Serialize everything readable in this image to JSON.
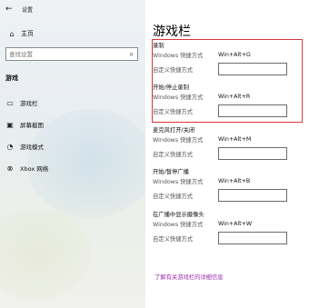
{
  "window": {
    "title": "设置"
  },
  "nav": {
    "home_label": "主页",
    "search_placeholder": "查找设置",
    "section": "游戏",
    "items": [
      {
        "label": "游戏栏",
        "icon": "game-bar-icon"
      },
      {
        "label": "屏幕截图",
        "icon": "capture-icon"
      },
      {
        "label": "游戏模式",
        "icon": "game-mode-icon"
      },
      {
        "label": "Xbox 网络",
        "icon": "xbox-icon"
      }
    ]
  },
  "main": {
    "title": "游戏栏",
    "groups": [
      {
        "title": "录制",
        "windows_label": "Windows 快捷方式",
        "windows_value": "Win+Alt+G",
        "custom_label": "自定义快捷方式",
        "custom_value": ""
      },
      {
        "title": "开始/停止录制",
        "windows_label": "Windows 快捷方式",
        "windows_value": "Win+Alt+R",
        "custom_label": "自定义快捷方式",
        "custom_value": ""
      },
      {
        "title": "麦克风打开/关闭",
        "windows_label": "Windows 快捷方式",
        "windows_value": "Win+Alt+M",
        "custom_label": "自定义快捷方式",
        "custom_value": ""
      },
      {
        "title": "开始/暂停广播",
        "windows_label": "Windows 快捷方式",
        "windows_value": "Win+Alt+B",
        "custom_label": "自定义快捷方式",
        "custom_value": ""
      },
      {
        "title": "在广播中显示摄像头",
        "windows_label": "Windows 快捷方式",
        "windows_value": "Win+Alt+W",
        "custom_label": "自定义快捷方式",
        "custom_value": ""
      }
    ],
    "link": "了解有关游戏栏的详细信息"
  },
  "colors": {
    "highlight": "#d9363e",
    "link": "#9b2fae"
  }
}
